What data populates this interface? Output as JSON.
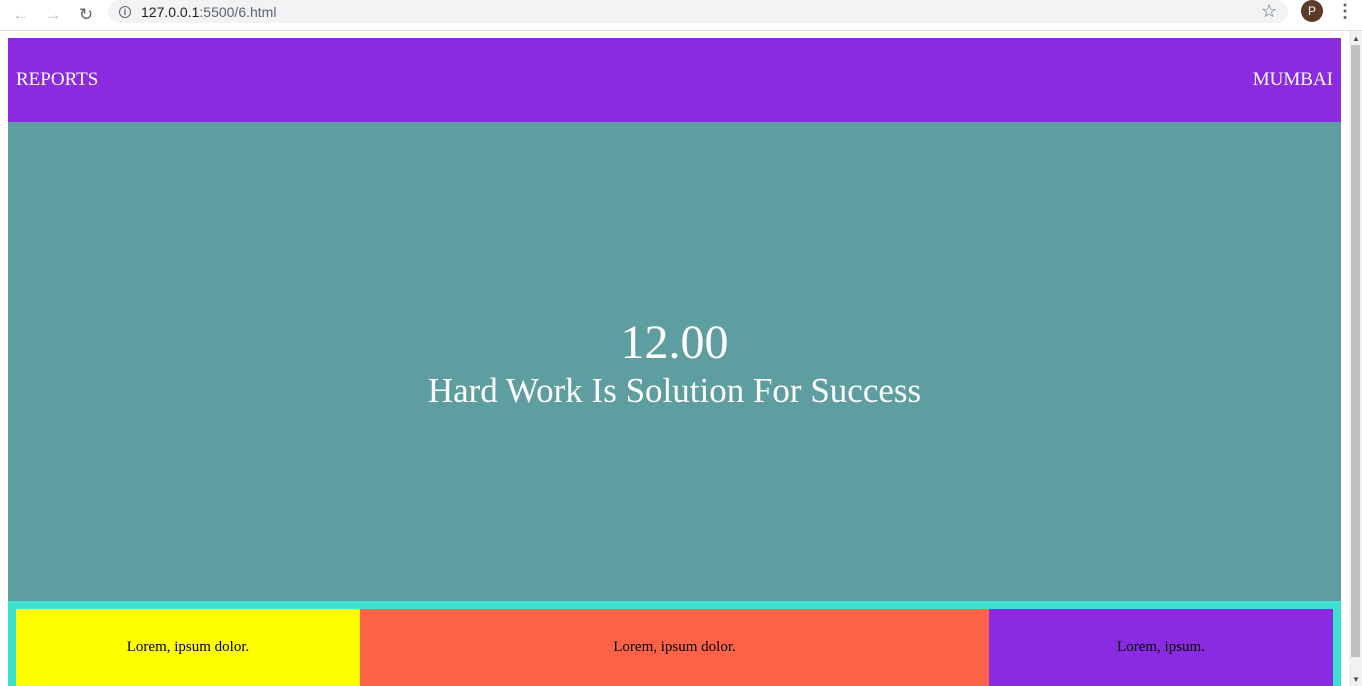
{
  "browser": {
    "url_host": "127.0.0.1",
    "url_path": ":5500/6.html",
    "avatar_letter": "P",
    "icons": {
      "back": "arrow-left-icon",
      "forward": "arrow-right-icon",
      "reload": "reload-icon",
      "info": "info-icon",
      "bookmark": "star-icon",
      "menu": "vertical-dots-icon"
    }
  },
  "header": {
    "left_label": "REPORTS",
    "right_label": "MUMBAI"
  },
  "hero": {
    "time": "12.00",
    "tagline": "Hard Work Is Solution For Success"
  },
  "footer": {
    "boxes": [
      {
        "text": "Lorem, ipsum dolor."
      },
      {
        "text": "Lorem, ipsum dolor."
      },
      {
        "text": "Lorem, ipsum."
      }
    ]
  },
  "colors": {
    "header_bg": "#8a2be2",
    "hero_bg": "#5f9ea0",
    "footer_bg": "#40e0d0",
    "box_1_bg": "#ffff00",
    "box_2_bg": "#ff6347",
    "box_3_bg": "#8a2be2"
  }
}
